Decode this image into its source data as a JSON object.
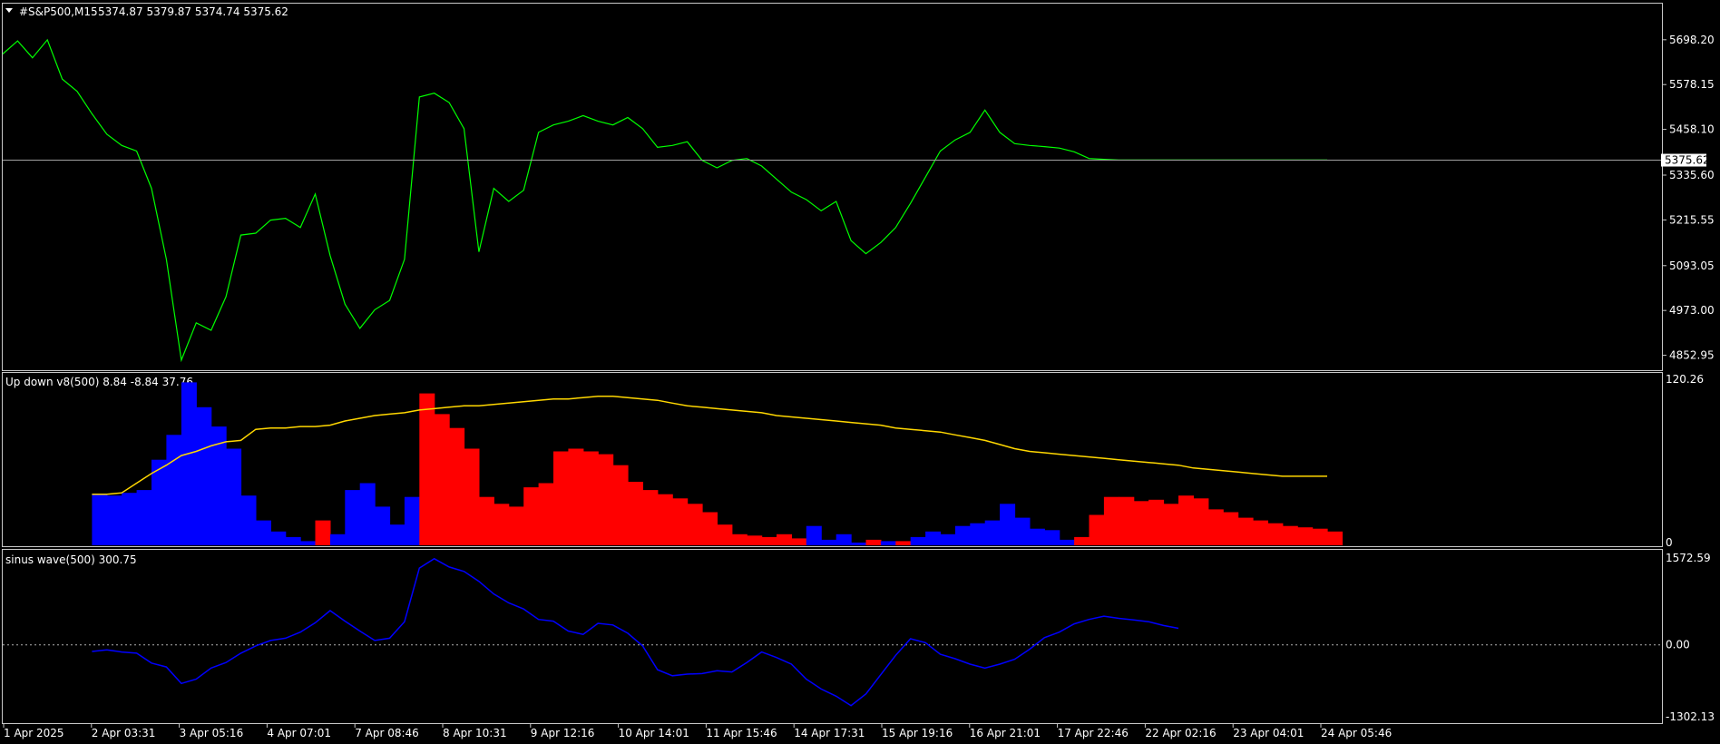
{
  "colors": {
    "background": "#000000",
    "frame": "#c8c8c8",
    "text": "#ffffff",
    "price_line": "#00ff00",
    "bid_line": "#a0a0a0",
    "up_hist": "#0000ff",
    "down_hist": "#ff0000",
    "avg_line": "#ffd700",
    "sine_line": "#0000ff",
    "zero_line": "#b0b0b0"
  },
  "chart_data": [
    {
      "type": "line",
      "name": "main",
      "symbol_header": "#S&P500,M15",
      "ohlc_text": "5374.87 5379.87 5374.74 5375.62",
      "current_price_label": "5375.62",
      "current_price": 5375.62,
      "y_ticks": [
        "5698.20",
        "5578.15",
        "5458.10",
        "5335.60",
        "5215.55",
        "5093.05",
        "4973.00",
        "4852.95"
      ],
      "ylim": [
        4813,
        5795
      ],
      "x": [
        0,
        3,
        6,
        9,
        12,
        15,
        18,
        21,
        24,
        27,
        30,
        33,
        36,
        39,
        42,
        45,
        48,
        51,
        54,
        57,
        60,
        63,
        66,
        69,
        72,
        75,
        78,
        81,
        84,
        87,
        90,
        93,
        96,
        99,
        102,
        105,
        108,
        111,
        114,
        117,
        120,
        123,
        126,
        129,
        132,
        135,
        138,
        141,
        144,
        147,
        150,
        153,
        156,
        159,
        162,
        165,
        168,
        171,
        174,
        177,
        180,
        183,
        186,
        189,
        192,
        195,
        198,
        201,
        204,
        207,
        210,
        213,
        216,
        219,
        222,
        225,
        228,
        231,
        234,
        237,
        240,
        243,
        246,
        249,
        252,
        255,
        258,
        261,
        264,
        267
      ],
      "values": [
        5660,
        5695,
        5650,
        5698,
        5593,
        5560,
        5500,
        5445,
        5415,
        5400,
        5300,
        5110,
        4840,
        4940,
        4920,
        5010,
        5175,
        5180,
        5215,
        5220,
        5195,
        5285,
        5120,
        4990,
        4925,
        4975,
        5000,
        5110,
        5545,
        5555,
        5530,
        5460,
        5130,
        5300,
        5265,
        5295,
        5450,
        5470,
        5480,
        5495,
        5480,
        5470,
        5490,
        5460,
        5410,
        5415,
        5425,
        5375,
        5355,
        5375,
        5380,
        5360,
        5325,
        5290,
        5270,
        5240,
        5265,
        5160,
        5125,
        5155,
        5195,
        5260,
        5330,
        5400,
        5430,
        5450,
        5510,
        5450,
        5420,
        5415,
        5412,
        5408,
        5398,
        5380,
        5378,
        5376,
        5376,
        5376,
        5376,
        5376,
        5376,
        5376,
        5376,
        5376,
        5376,
        5376,
        5376,
        5376,
        5376,
        5376
      ]
    },
    {
      "type": "bar",
      "name": "up_down",
      "header": "Up down v8(500) 8.84 -8.84 37.76",
      "y_ticks": [
        "120.26",
        "0"
      ],
      "ylim": [
        0,
        120.26
      ],
      "x": [
        18,
        21,
        24,
        27,
        30,
        33,
        36,
        39,
        42,
        45,
        48,
        51,
        54,
        57,
        60,
        63,
        66,
        69,
        72,
        75,
        78,
        81,
        84,
        87,
        90,
        93,
        96,
        99,
        102,
        105,
        108,
        111,
        114,
        117,
        120,
        123,
        126,
        129,
        132,
        135,
        138,
        141,
        144,
        147,
        150,
        153,
        156,
        159,
        162,
        165,
        168,
        171,
        174,
        177,
        180,
        183,
        186,
        189,
        192,
        195,
        198,
        201,
        204,
        207,
        210,
        213,
        216,
        219,
        222,
        225,
        228,
        231,
        234,
        237,
        240,
        243,
        246,
        249,
        252,
        255,
        258,
        261,
        264,
        267
      ],
      "values": [
        37,
        36,
        38,
        40,
        62,
        80,
        118,
        100,
        86,
        70,
        36,
        18,
        10,
        6,
        3,
        -18,
        8,
        40,
        45,
        28,
        15,
        35,
        -110,
        -95,
        -85,
        -70,
        -35,
        -30,
        -28,
        -42,
        -45,
        -68,
        -70,
        -68,
        -66,
        -58,
        -46,
        -40,
        -37,
        -34,
        -30,
        -24,
        -15,
        -8,
        -7,
        -6,
        -8,
        -5,
        14,
        4,
        8,
        2,
        -4,
        3,
        -3,
        6,
        10,
        8,
        14,
        16,
        18,
        30,
        20,
        12,
        11,
        4,
        -6,
        -22,
        -35,
        -35,
        -32,
        -33,
        -30,
        -36,
        -34,
        -26,
        -24,
        -20,
        -18,
        -16,
        -14,
        -13,
        -12,
        -10
      ],
      "avg_line": [
        37,
        37,
        38,
        45,
        52,
        58,
        65,
        68,
        72,
        75,
        76,
        84,
        85,
        85,
        86,
        86,
        87,
        90,
        92,
        94,
        95,
        96,
        98,
        99,
        100,
        101,
        101,
        102,
        103,
        104,
        105,
        106,
        106,
        107,
        108,
        108,
        107,
        106,
        105,
        103,
        101,
        100,
        99,
        98,
        97,
        96,
        94,
        93,
        92,
        91,
        90,
        89,
        88,
        87,
        85,
        84,
        83,
        82,
        80,
        78,
        76,
        73,
        70,
        68,
        67,
        66,
        65,
        64,
        63,
        62,
        61,
        60,
        59,
        58,
        56,
        55,
        54,
        53,
        52,
        51,
        50,
        50,
        50,
        50
      ]
    },
    {
      "type": "line",
      "name": "sinus",
      "header": "sinus wave(500) 300.75",
      "y_ticks": [
        "1572.59",
        "0.00",
        "-1302.13"
      ],
      "ylim": [
        -1302.13,
        1572.59
      ],
      "zero_level": 0,
      "x": [
        18,
        21,
        24,
        27,
        30,
        33,
        36,
        39,
        42,
        45,
        48,
        51,
        54,
        57,
        60,
        63,
        66,
        69,
        72,
        75,
        78,
        81,
        84,
        87,
        90,
        93,
        96,
        99,
        102,
        105,
        108,
        111,
        114,
        117,
        120,
        123,
        126,
        129,
        132,
        135,
        138,
        141,
        144,
        147,
        150,
        153,
        156,
        159,
        162,
        165,
        168,
        171,
        174,
        177,
        180,
        183,
        186,
        189,
        192,
        195,
        198,
        201,
        204,
        207,
        210,
        213,
        216,
        219,
        222,
        225,
        228,
        231,
        234,
        237,
        240,
        243,
        246,
        249,
        252,
        255,
        258,
        261,
        264,
        267
      ],
      "values": [
        -120,
        -90,
        -130,
        -150,
        -330,
        -400,
        -700,
        -620,
        -420,
        -320,
        -150,
        -20,
        80,
        120,
        230,
        400,
        620,
        430,
        250,
        80,
        120,
        420,
        1390,
        1560,
        1410,
        1330,
        1150,
        920,
        760,
        650,
        460,
        430,
        250,
        190,
        390,
        360,
        210,
        -20,
        -450,
        -560,
        -530,
        -520,
        -470,
        -490,
        -320,
        -130,
        -230,
        -350,
        -620,
        -800,
        -930,
        -1100,
        -890,
        -540,
        -190,
        110,
        40,
        -170,
        -250,
        -350,
        -420,
        -350,
        -260,
        -80,
        130,
        230,
        380,
        460,
        520,
        480,
        450,
        420,
        350,
        300
      ]
    }
  ],
  "x_axis": {
    "labels": [
      "1 Apr 2025",
      "2 Apr 03:31",
      "3 Apr 05:16",
      "4 Apr 07:01",
      "7 Apr 08:46",
      "8 Apr 10:31",
      "9 Apr 12:16",
      "10 Apr 14:01",
      "11 Apr 15:46",
      "14 Apr 17:31",
      "15 Apr 19:16",
      "16 Apr 21:01",
      "17 Apr 22:46",
      "22 Apr 02:16",
      "23 Apr 04:01",
      "24 Apr 05:46"
    ]
  }
}
